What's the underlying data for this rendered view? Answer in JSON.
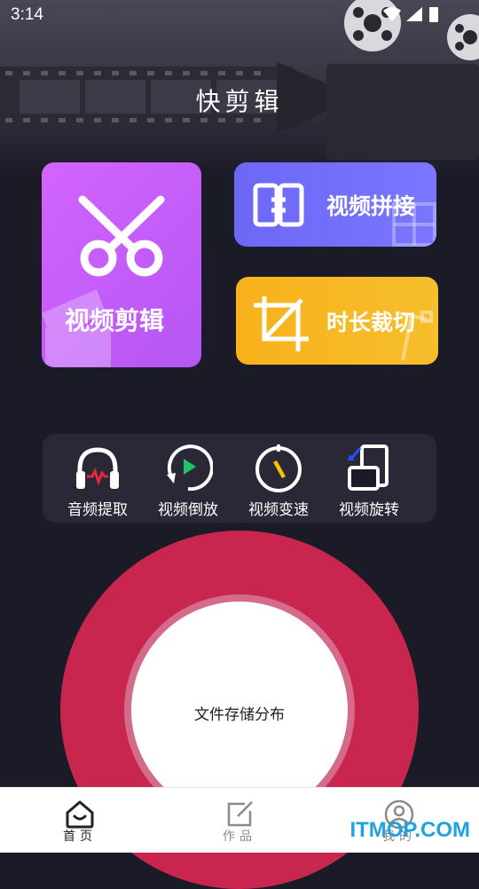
{
  "status": {
    "time": "3:14"
  },
  "app": {
    "title": "快剪辑"
  },
  "tiles": {
    "edit": {
      "label": "视频剪辑",
      "icon": "scissors-icon"
    },
    "join": {
      "label": "视频拼接",
      "icon": "join-icon"
    },
    "trim": {
      "label": "时长裁切",
      "icon": "crop-icon"
    }
  },
  "tools": [
    {
      "label": "音频提取",
      "icon": "headphones-icon"
    },
    {
      "label": "视频倒放",
      "icon": "reverse-play-icon"
    },
    {
      "label": "视频变速",
      "icon": "speed-gauge-icon"
    },
    {
      "label": "视频旋转",
      "icon": "rotate-icon"
    }
  ],
  "storage": {
    "label": "文件存储分布"
  },
  "nav": [
    {
      "label": "首页",
      "icon": "home-icon",
      "active": true
    },
    {
      "label": "作品",
      "icon": "edit-note-icon",
      "active": false
    },
    {
      "label": "我的",
      "icon": "user-icon",
      "active": false
    }
  ],
  "watermark": {
    "text": "ITMOP.COM"
  },
  "colors": {
    "background": "#1b1a27",
    "edit_tile": "#c45cfa",
    "join_tile": "#7470fb",
    "trim_tile": "#f7b621",
    "storage_ring": "#c8264f",
    "nav_active": "#222222",
    "nav_inactive": "#8a8a8a"
  }
}
